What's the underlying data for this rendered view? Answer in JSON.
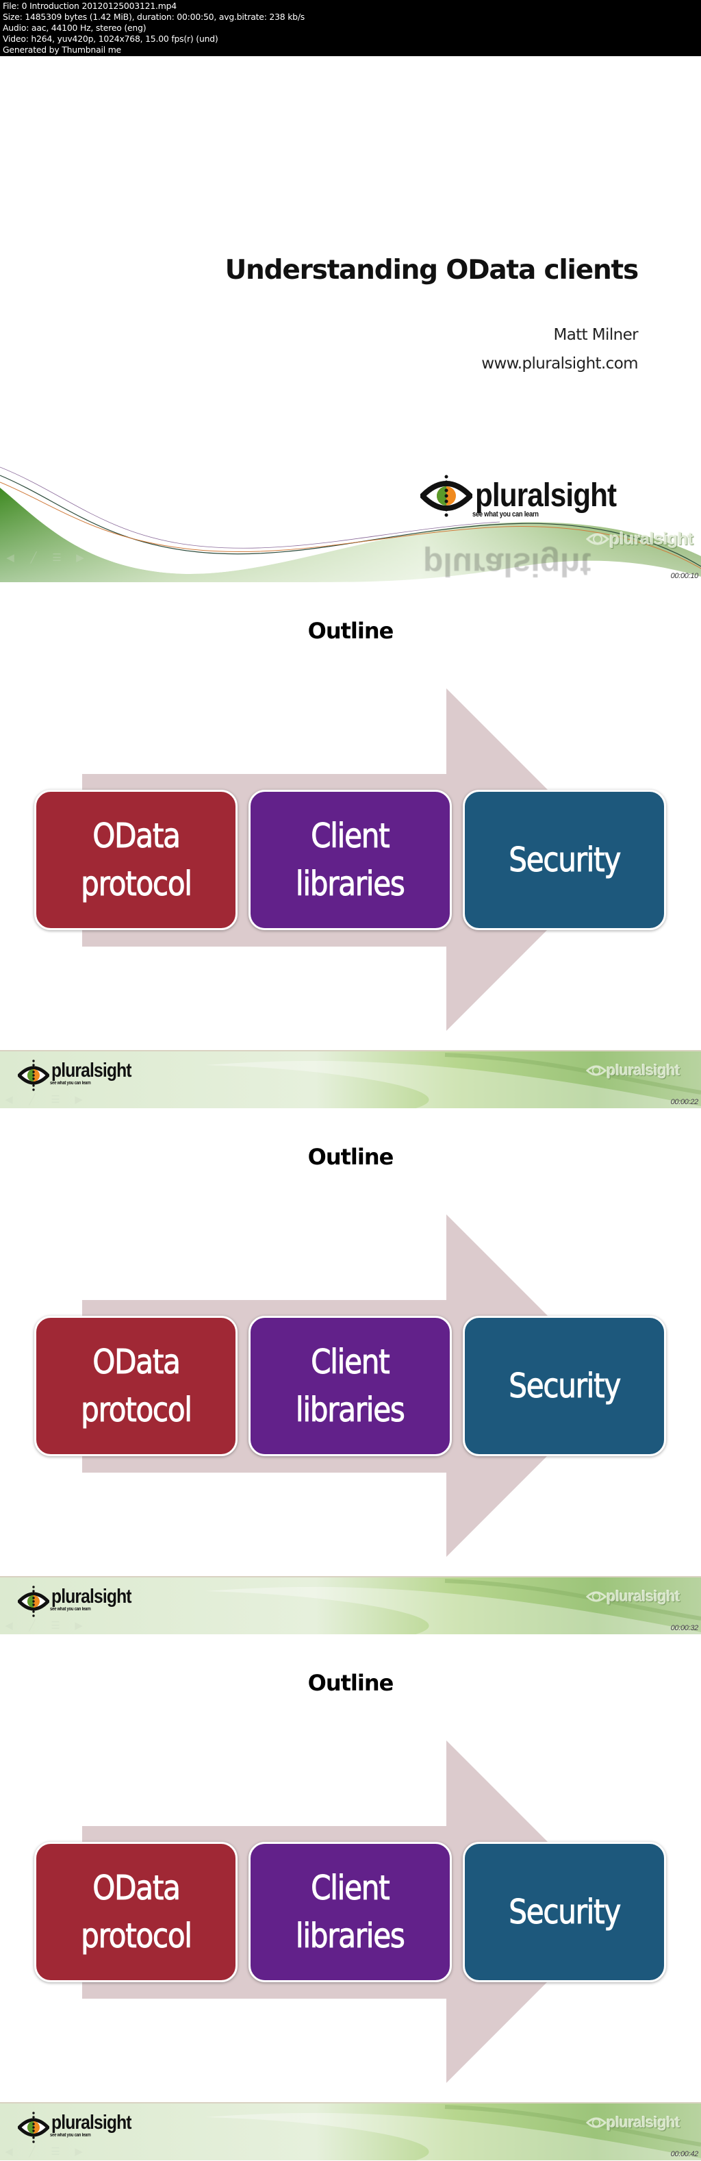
{
  "info_header": {
    "lines": [
      "File: 0 Introduction 20120125003121.mp4",
      "Size: 1485309 bytes (1.42 MiB), duration: 00:00:50, avg.bitrate: 238 kb/s",
      "Audio: aac, 44100 Hz, stereo (eng)",
      "Video: h264, yuv420p, 1024x768, 15.00 fps(r) (und)",
      "Generated by Thumbnail me"
    ]
  },
  "brand": {
    "name": "pluralsight",
    "tagline": "see what you can learn",
    "colors": {
      "eye_green": "#5a9a2a",
      "eye_orange": "#f08a1e",
      "swoosh_green": "#4f8f2a",
      "footer_green_light": "#dcebcf",
      "footer_green_dark": "#8cbc6a"
    }
  },
  "player_controls": [
    {
      "name": "previous",
      "icon": "prev-icon"
    },
    {
      "name": "pen",
      "icon": "pen-icon"
    },
    {
      "name": "menu",
      "icon": "menu-icon"
    },
    {
      "name": "next",
      "icon": "next-icon"
    }
  ],
  "slides": [
    {
      "type": "title",
      "title": "Understanding OData clients",
      "author": "Matt Milner",
      "website": "www.pluralsight.com",
      "timestamp": "00:00:10"
    },
    {
      "type": "outline",
      "title": "Outline",
      "timestamp": "00:00:22",
      "steps": [
        {
          "label": "OData protocol",
          "line1": "OData",
          "line2": "protocol",
          "color": "#a02835"
        },
        {
          "label": "Client libraries",
          "line1": "Client",
          "line2": "libraries",
          "color": "#62218a"
        },
        {
          "label": "Security",
          "line1": "Security",
          "line2": "",
          "color": "#1d587c"
        }
      ],
      "arrow_color": "#dccbcd"
    },
    {
      "type": "outline",
      "title": "Outline",
      "timestamp": "00:00:32",
      "steps": [
        {
          "label": "OData protocol",
          "line1": "OData",
          "line2": "protocol",
          "color": "#a02835"
        },
        {
          "label": "Client libraries",
          "line1": "Client",
          "line2": "libraries",
          "color": "#62218a"
        },
        {
          "label": "Security",
          "line1": "Security",
          "line2": "",
          "color": "#1d587c"
        }
      ],
      "arrow_color": "#dccbcd"
    },
    {
      "type": "outline",
      "title": "Outline",
      "timestamp": "00:00:42",
      "steps": [
        {
          "label": "OData protocol",
          "line1": "OData",
          "line2": "protocol",
          "color": "#a02835"
        },
        {
          "label": "Client libraries",
          "line1": "Client",
          "line2": "libraries",
          "color": "#62218a"
        },
        {
          "label": "Security",
          "line1": "Security",
          "line2": "",
          "color": "#1d587c"
        }
      ],
      "arrow_color": "#dccbcd"
    }
  ]
}
